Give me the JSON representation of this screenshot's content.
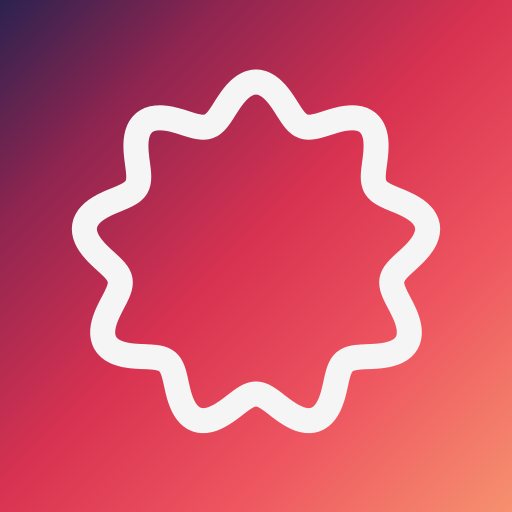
{
  "icon": {
    "name": "wavy-badge-icon",
    "gradient": {
      "top_left": "#2b2250",
      "upper": "#8f2550",
      "middle": "#d83251",
      "lower": "#ee5560",
      "bottom_right": "#f6916f"
    },
    "outline_color": "#f5f5f5"
  }
}
